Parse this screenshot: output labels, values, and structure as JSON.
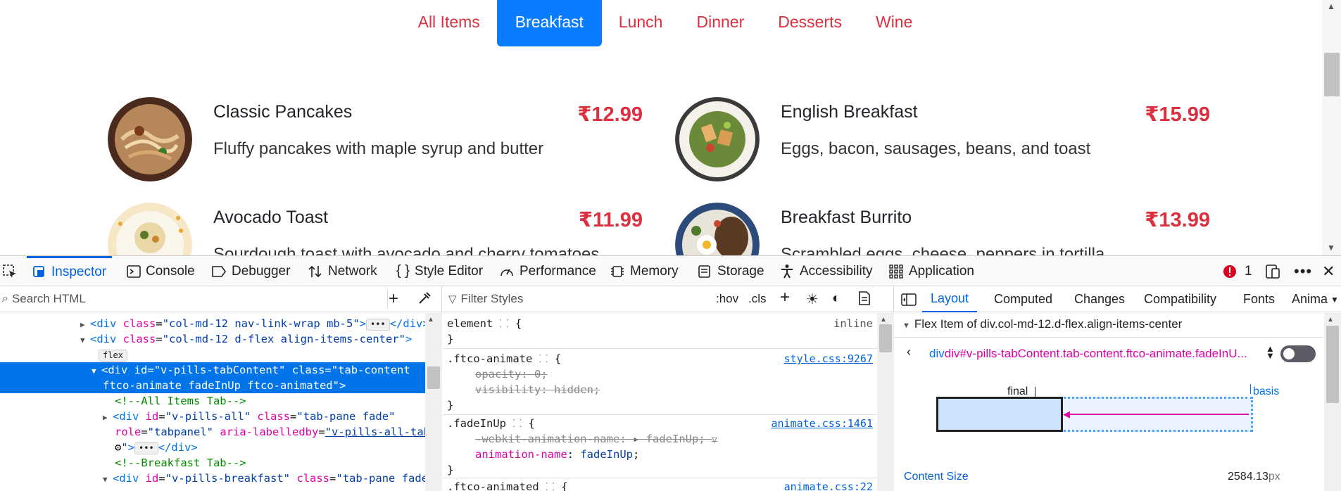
{
  "nav": {
    "tabs": [
      {
        "label": "All Items",
        "active": false
      },
      {
        "label": "Breakfast",
        "active": true
      },
      {
        "label": "Lunch",
        "active": false
      },
      {
        "label": "Dinner",
        "active": false
      },
      {
        "label": "Desserts",
        "active": false
      },
      {
        "label": "Wine",
        "active": false
      }
    ]
  },
  "menu": {
    "items": [
      {
        "name": "Classic Pancakes",
        "description": "Fluffy pancakes with maple syrup and butter",
        "price": "₹12.99"
      },
      {
        "name": "English Breakfast",
        "description": "Eggs, bacon, sausages, beans, and toast",
        "price": "₹15.99"
      },
      {
        "name": "Avocado Toast",
        "description": "Sourdough toast with avocado and cherry tomatoes",
        "price": "₹11.99"
      },
      {
        "name": "Breakfast Burrito",
        "description": "Scrambled eggs, cheese, peppers in tortilla",
        "price": "₹13.99"
      }
    ]
  },
  "devtools": {
    "tabs": [
      "Inspector",
      "Console",
      "Debugger",
      "Network",
      "Style Editor",
      "Performance",
      "Memory",
      "Storage",
      "Accessibility",
      "Application"
    ],
    "error_count": "1",
    "search_placeholder": "Search HTML",
    "filter_placeholder": "Filter Styles",
    "hov": ":hov",
    "cls": ".cls",
    "html": {
      "line1_attr_val": "col-md-12 nav-link-wrap mb-5",
      "line2_attr_val": "col-md-12 d-flex align-items-center",
      "flex_badge": "flex",
      "sel_id": "v-pills-tabContent",
      "sel_class_1": "tab-content",
      "sel_class_2": "ftco-animate fadeInUp ftco-animated",
      "comment1": "<!--All Items Tab-->",
      "all_id": "v-pills-all",
      "all_class": "tab-pane fade",
      "all_role": "tabpanel",
      "all_labelledby": "v-pills-all-tab",
      "comment2": "<!--Breakfast Tab-->",
      "bf_id": "v-pills-breakfast",
      "bf_class": "tab-pane fade"
    },
    "rules": {
      "element_selector": "element",
      "element_inline": "inline",
      "r1_selector": ".ftco-animate",
      "r1_src": "style.css:9267",
      "r1_p1": "opacity",
      "r1_v1": "0",
      "r1_p2": "visibility",
      "r1_v2": "hidden",
      "r2_selector": ".fadeInUp",
      "r2_src": "animate.css:1461",
      "r2_p1": "-webkit-animation-name",
      "r2_v1": "fadeInUp",
      "r2_p2": "animation-name",
      "r2_v2": "fadeInUp",
      "r3_selector": ".ftco-animated",
      "r3_src": "animate.css:22"
    },
    "right_tabs": [
      "Layout",
      "Computed",
      "Changes",
      "Compatibility",
      "Fonts",
      "Anima"
    ],
    "flex_item_title": "Flex Item of div.col-md-12.d-flex.align-items-center",
    "flex_container": "div#v-pills-tabContent.tab-content.ftco-animate.fadeInU...",
    "label_final": "final",
    "label_basis": "basis",
    "content_size_label": "Content Size",
    "content_size_value": "2584.13",
    "content_size_unit": "px"
  },
  "colors": {
    "accent_red": "#dc2f3f",
    "active_tab_bg": "#0a7cff",
    "devtools_blue": "#0061e0"
  }
}
